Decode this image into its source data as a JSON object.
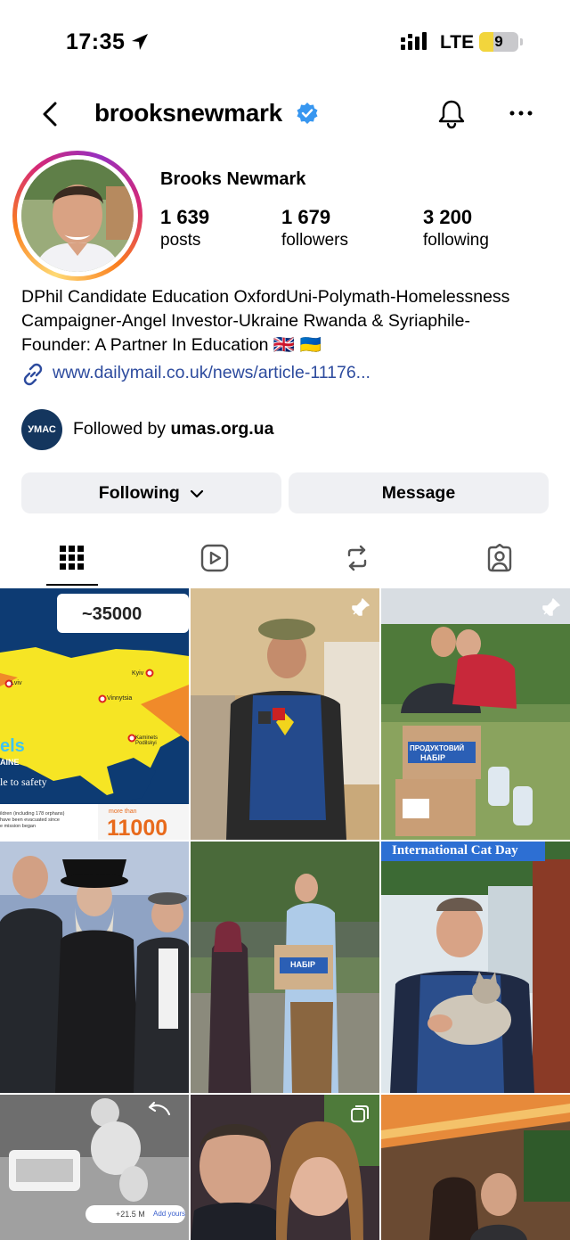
{
  "status_bar": {
    "time": "17:35",
    "network": "LTE",
    "battery": "9"
  },
  "profile": {
    "username": "brooksnewmark",
    "display_name": "Brooks Newmark",
    "verified": true,
    "stats": {
      "posts_value": "1 639",
      "posts_label": "posts",
      "followers_value": "1 679",
      "followers_label": "followers",
      "following_value": "3 200",
      "following_label": "following"
    },
    "bio_lines": [
      "DPhil Candidate Education OxfordUni-Polymath-Homelessness",
      "Campaigner-Angel Investor-Ukraine Rwanda & Syriaphile-",
      "Founder: A Partner In Education 🇬🇧 🇺🇦"
    ],
    "link": "www.dailymail.co.uk/news/article-11176...",
    "followed_by_prefix": "Followed by",
    "followed_by_account": "umas.org.ua",
    "followed_by_logo_text": "УМАС"
  },
  "buttons": {
    "following_label": "Following",
    "message_label": "Message"
  },
  "tabs": [
    "posts-grid",
    "reels",
    "reposts",
    "tagged"
  ],
  "grid": {
    "post1": {
      "count_label": "~35000",
      "cities": [
        "Kyiv",
        "Lviv",
        "Vinnytsia",
        "Kaminets Podilskyi"
      ],
      "side_text_1": "els",
      "side_text_2": "AINE",
      "side_text_3": "le to safety",
      "footer_small": "ildren (including 178 orphans)\nhave been evacuated since\ne mission began",
      "more_than": "more than",
      "big_number": "11000"
    },
    "post3": {
      "box_text_1": "ПРОДУКТОВИЙ",
      "box_text_2": "НАБІР"
    },
    "post5": {
      "box_text": "НАБІР"
    },
    "post6": {
      "banner": "International Cat Day"
    },
    "post7": {
      "views": "+21.5 M",
      "add_yours": "Add yours"
    }
  },
  "colors": {
    "link": "#2d4b9e",
    "verified": "#3897f0",
    "button_bg": "#eff0f3",
    "umas_logo": "#14365e",
    "map_yellow": "#f6e524",
    "map_blue": "#0d3b73"
  }
}
